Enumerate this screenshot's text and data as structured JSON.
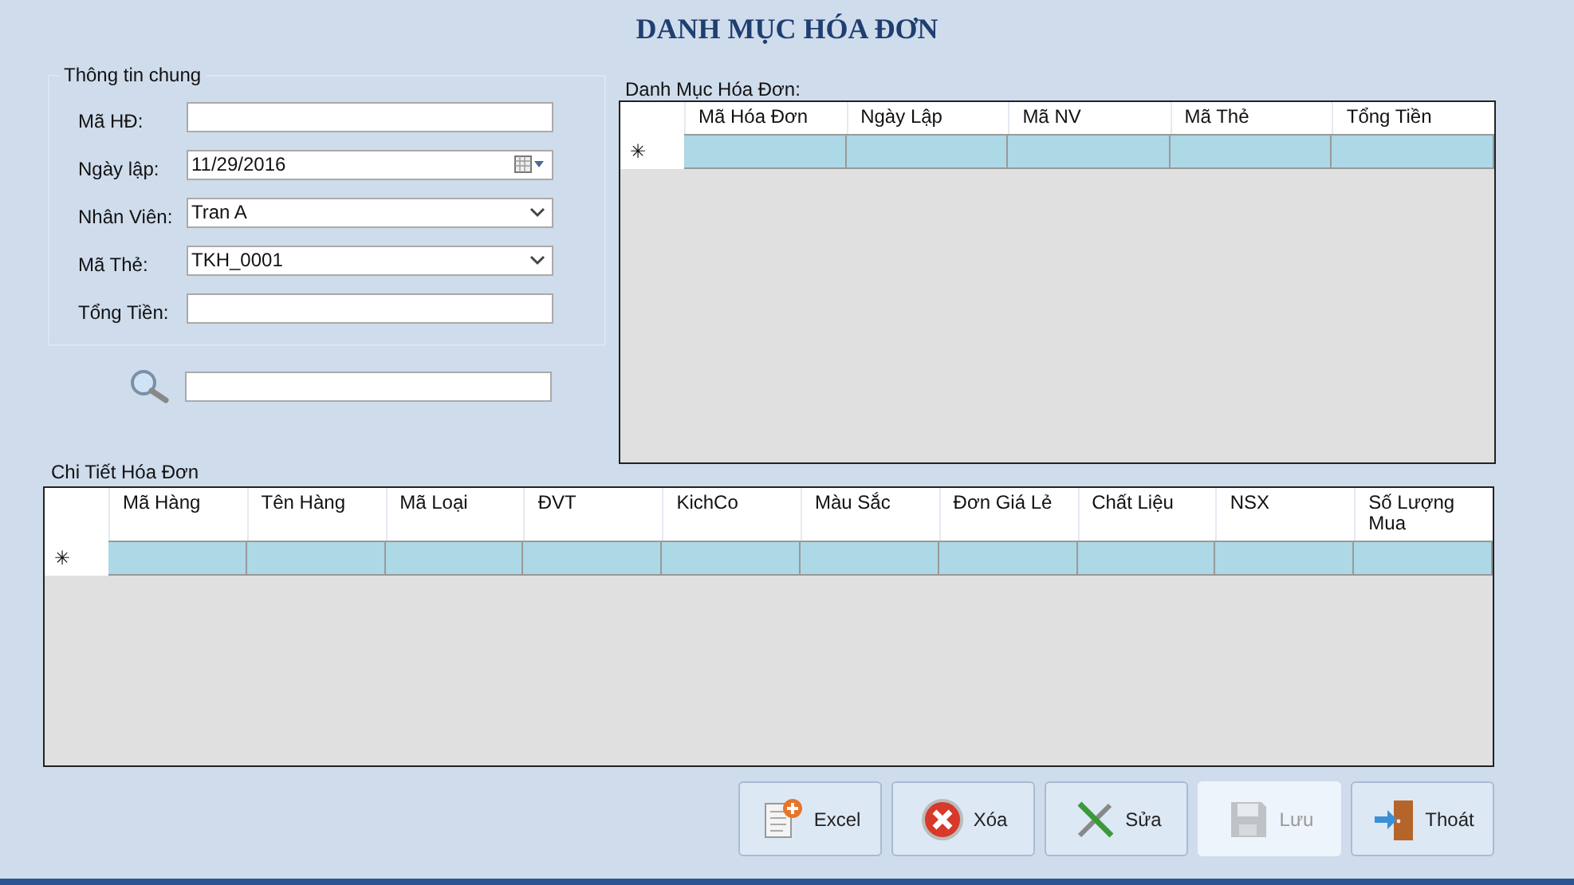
{
  "title": "DANH MỤC HÓA ĐƠN",
  "general": {
    "title": "Thông tin chung",
    "fields": [
      {
        "label": "Mã HĐ:",
        "kind": "text"
      },
      {
        "label": "Ngày lập:",
        "kind": "date",
        "value": "11/29/2016"
      },
      {
        "label": "Nhân Viên:",
        "kind": "combo",
        "value": "Tran A"
      },
      {
        "label": "Mã Thẻ:",
        "kind": "combo",
        "value": "TKH_0001"
      },
      {
        "label": "Tổng Tiền:",
        "kind": "text"
      }
    ]
  },
  "invoice_list": {
    "title": "Danh Mục Hóa Đơn:",
    "new_row_marker": "✳",
    "columns": [
      "Mã Hóa Đơn",
      "Ngày Lập",
      "Mã NV",
      "Mã Thẻ",
      "Tổng Tiền"
    ]
  },
  "details": {
    "title": "Chi Tiết Hóa Đơn",
    "new_row_marker": "✳",
    "columns": [
      "Mã Hàng",
      "Tên Hàng",
      "Mã Loại",
      "ĐVT",
      "KichCo",
      "Màu Sắc",
      "Đơn Giá Lẻ",
      "Chất Liệu",
      "NSX",
      "Số Lượng Mua"
    ]
  },
  "buttons": [
    {
      "label": "Excel",
      "kind": "excel",
      "disabled": false
    },
    {
      "label": "Xóa",
      "kind": "delete",
      "disabled": false
    },
    {
      "label": "Sửa",
      "kind": "edit",
      "disabled": false
    },
    {
      "label": "Lưu",
      "kind": "save",
      "disabled": true
    },
    {
      "label": "Thoát",
      "kind": "exit",
      "disabled": false
    }
  ]
}
